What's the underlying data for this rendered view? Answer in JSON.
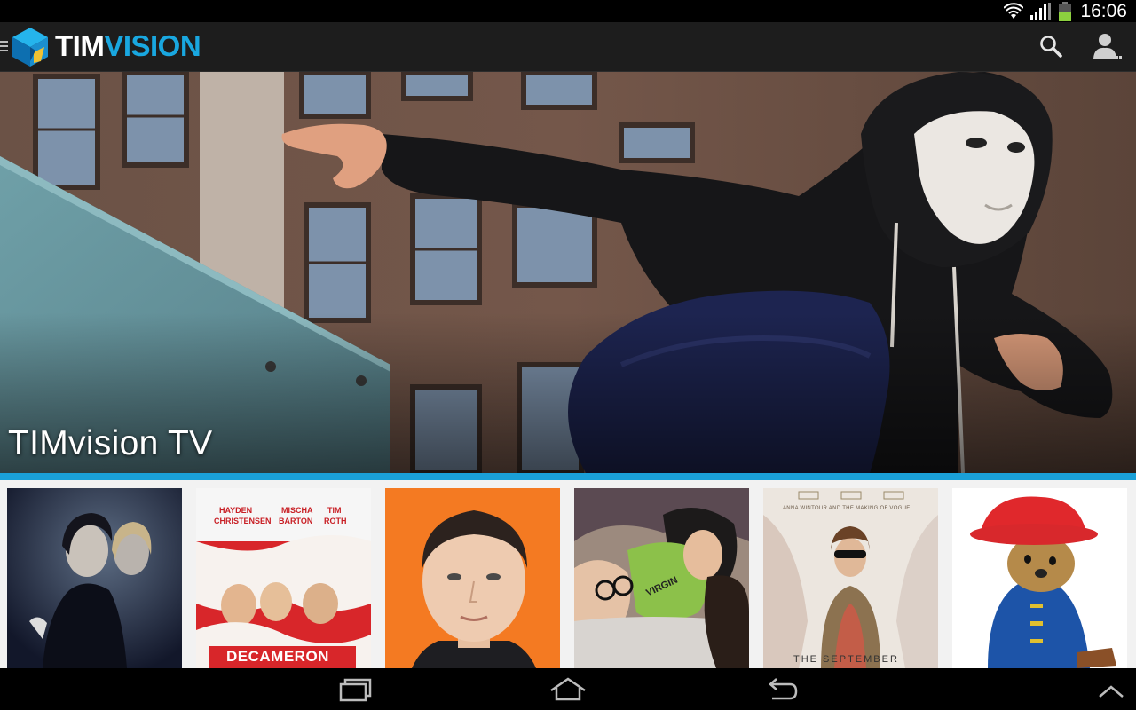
{
  "status_bar": {
    "time": "16:06",
    "icons": [
      "wifi-icon",
      "signal-icon",
      "battery-icon"
    ]
  },
  "action_bar": {
    "brand_part1": "TIM",
    "brand_part2": "VISION",
    "icons": [
      "menu-icon",
      "search-icon",
      "user-icon"
    ]
  },
  "hero": {
    "title": "TIMvision TV"
  },
  "posters": [
    {
      "name": "poster-1"
    },
    {
      "name": "poster-2",
      "actor1_first": "HAYDEN",
      "actor1_last": "CHRISTENSEN",
      "actor2_first": "MISCHA",
      "actor2_last": "BARTON",
      "actor3_first": "TIM",
      "actor3_last": "ROTH",
      "title": "DECAMERON"
    },
    {
      "name": "poster-3"
    },
    {
      "name": "poster-4",
      "text": "VIRGIN"
    },
    {
      "name": "poster-5",
      "tagline": "ANNA WINTOUR AND THE MAKING OF VOGUE",
      "title": "THE SEPTEMBER"
    },
    {
      "name": "poster-6"
    }
  ],
  "nav_bar": {
    "icons": [
      "recent-apps-icon",
      "home-icon",
      "back-icon",
      "chevron-up-icon"
    ]
  },
  "colors": {
    "accent": "#1aa0d8",
    "action_bar": "#1d1d1d",
    "brand_blue": "#19a7e0"
  }
}
